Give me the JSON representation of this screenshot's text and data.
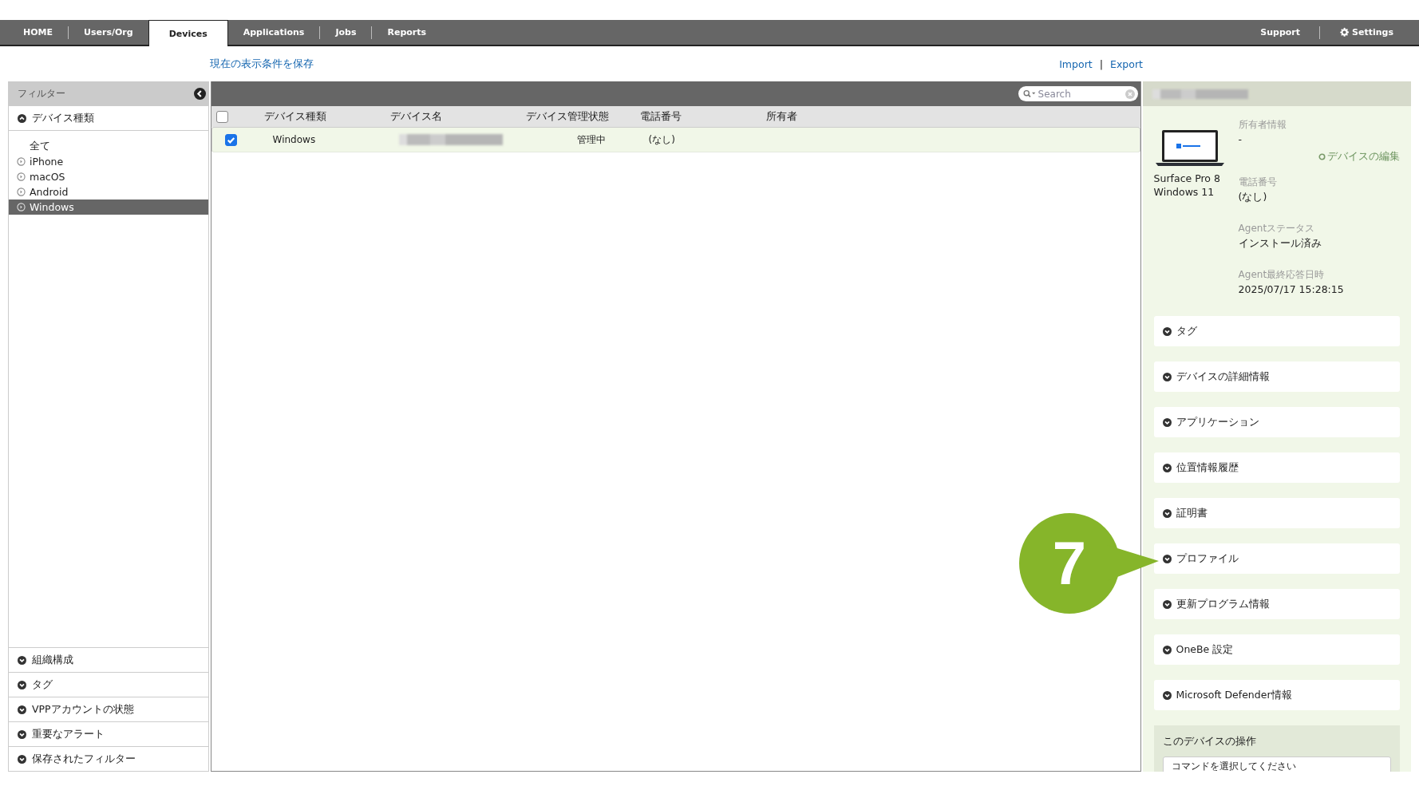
{
  "nav": {
    "tabs": [
      {
        "label": "HOME",
        "selected": false
      },
      {
        "label": "Users/Org",
        "selected": false
      },
      {
        "label": "Devices",
        "selected": true
      },
      {
        "label": "Applications",
        "selected": false
      },
      {
        "label": "Jobs",
        "selected": false
      },
      {
        "label": "Reports",
        "selected": false
      }
    ],
    "right": [
      {
        "label": "Support",
        "kind": "link"
      },
      {
        "label": "Settings",
        "kind": "gear"
      }
    ]
  },
  "save_link": "現在の表示条件を保存",
  "import_link": "Import",
  "link_separator": "|",
  "export_link": "Export",
  "sidebar": {
    "title": "フィルター",
    "section": {
      "label": "デバイス種類",
      "expanded": true
    },
    "items": [
      {
        "label": "全て",
        "kind": "all",
        "selected": false
      },
      {
        "label": "iPhone",
        "kind": "option",
        "selected": false
      },
      {
        "label": "macOS",
        "kind": "option",
        "selected": false
      },
      {
        "label": "Android",
        "kind": "option",
        "selected": false
      },
      {
        "label": "Windows",
        "kind": "option",
        "selected": true
      }
    ],
    "bottom_sections": [
      {
        "label": "組織構成",
        "expanded": false
      },
      {
        "label": "タグ",
        "expanded": false
      },
      {
        "label": "VPPアカウントの状態",
        "expanded": false
      },
      {
        "label": "重要なアラート",
        "expanded": false
      },
      {
        "label": "保存されたフィルター",
        "expanded": false
      }
    ]
  },
  "table": {
    "search": {
      "placeholder": "Search"
    },
    "header_checked": false,
    "columns": [
      "デバイス種類",
      "デバイス名",
      "デバイス管理状態",
      "電話番号",
      "所有者"
    ],
    "rows": [
      {
        "checked": true,
        "selected": true,
        "type": "Windows",
        "status": "管理中",
        "phone": "(なし)"
      }
    ]
  },
  "detail": {
    "model": "Surface Pro 8",
    "os": "Windows 11",
    "edit_link": "デバイスの編集",
    "fields": [
      {
        "label": "所有者情報",
        "value": "-"
      },
      {
        "label": "電話番号",
        "value": "(なし)"
      },
      {
        "label": "Agentステータス",
        "value": "インストール済み"
      },
      {
        "label": "Agent最終応答日時",
        "value": "2025/07/17 15:28:15"
      }
    ],
    "sections": [
      {
        "label": "タグ",
        "expanded": false
      },
      {
        "label": "デバイスの詳細情報",
        "expanded": false
      },
      {
        "label": "アプリケーション",
        "expanded": false
      },
      {
        "label": "位置情報履歴",
        "expanded": false
      },
      {
        "label": "証明書",
        "expanded": false
      },
      {
        "label": "プロファイル",
        "expanded": false
      },
      {
        "label": "更新プログラム情報",
        "expanded": false
      },
      {
        "label": "OneBe 設定",
        "expanded": false
      },
      {
        "label": "Microsoft Defender情報",
        "expanded": false
      }
    ],
    "actions": {
      "title": "このデバイスの操作",
      "placeholder": "コマンドを選択してください"
    }
  },
  "callout": "7"
}
